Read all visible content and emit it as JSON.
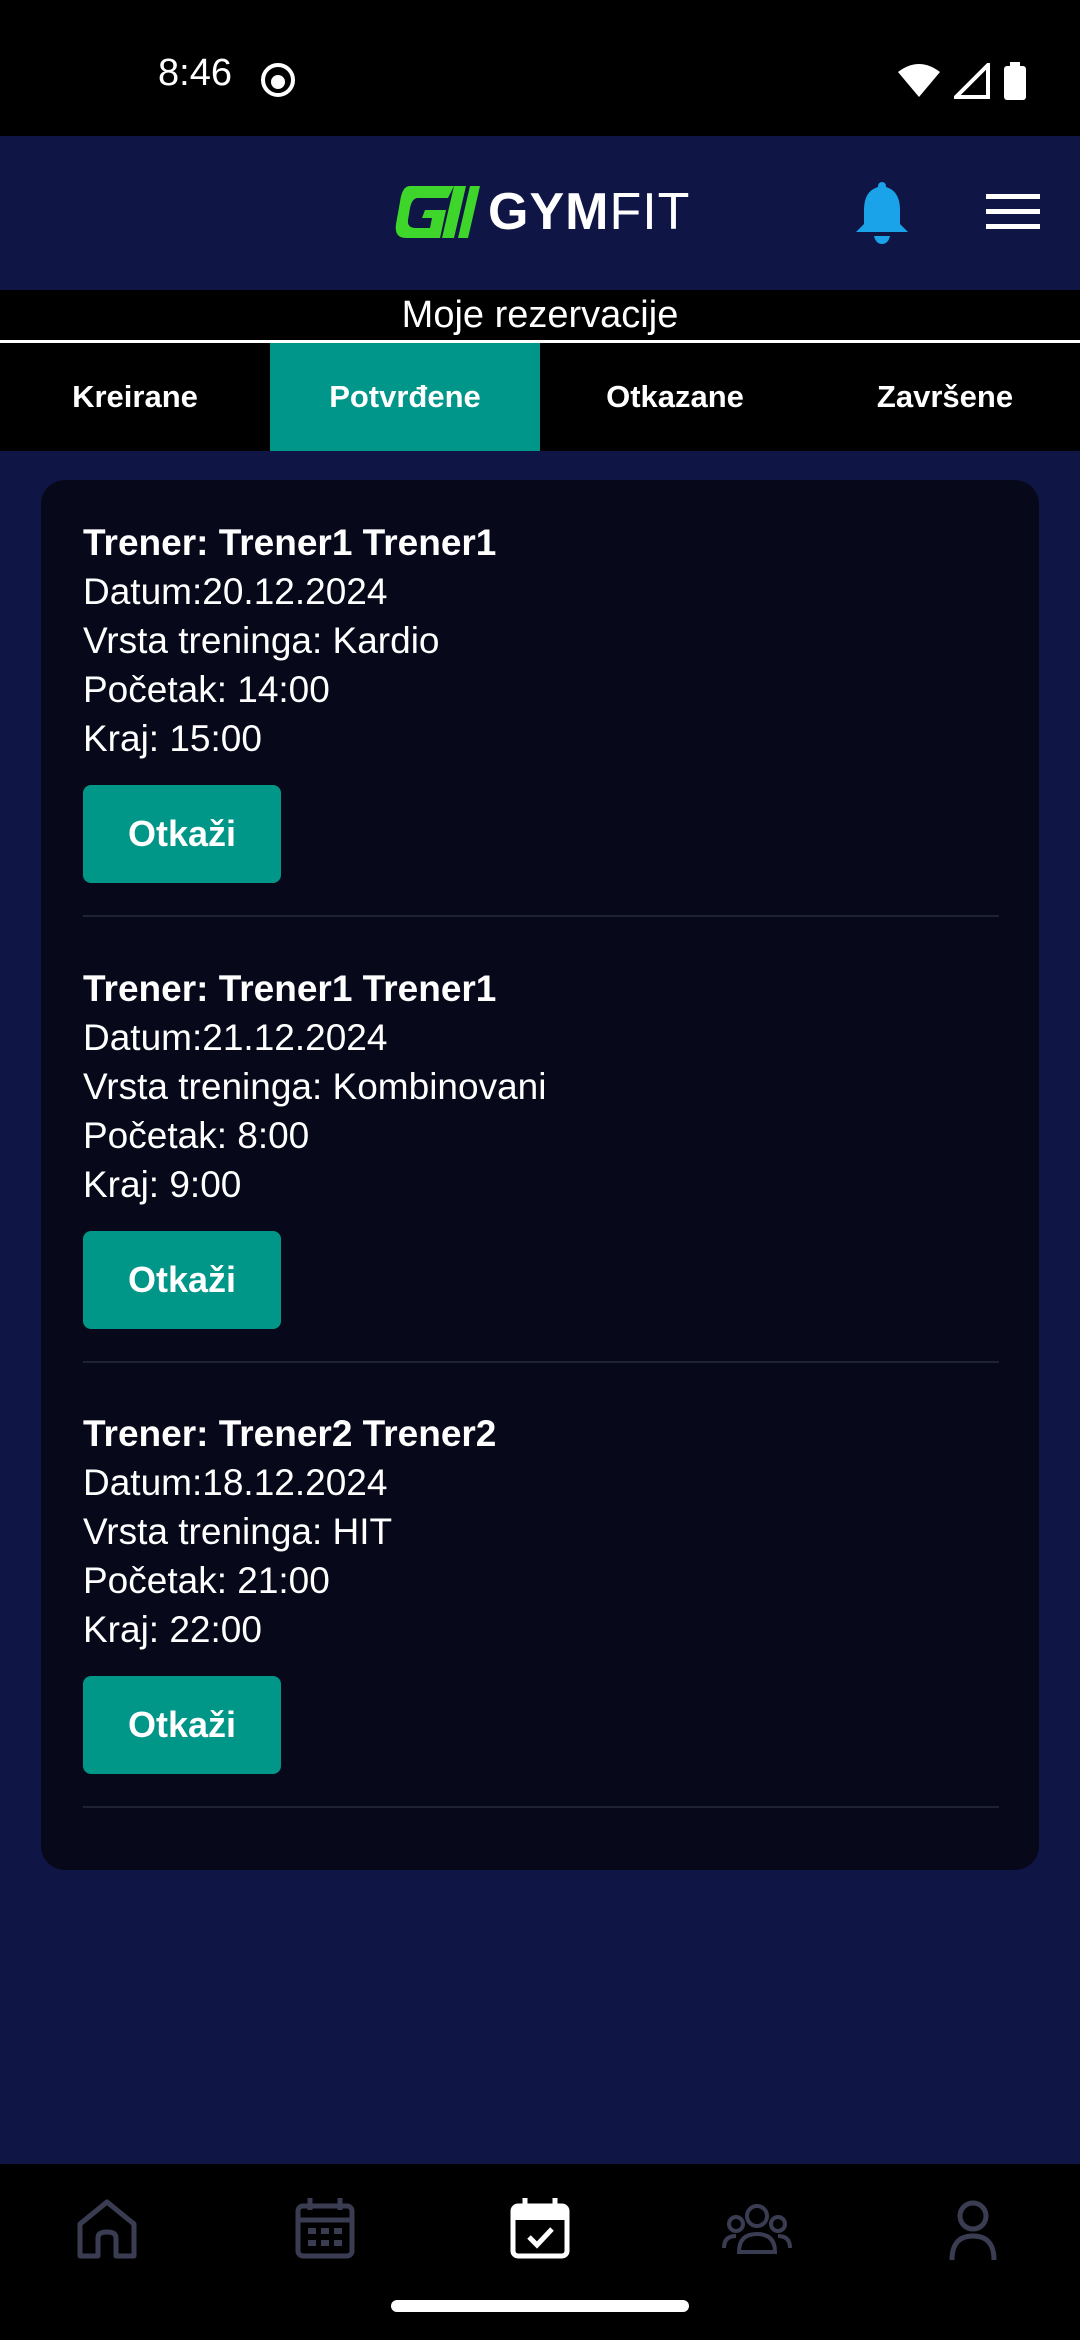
{
  "status_bar": {
    "time": "8:46"
  },
  "header": {
    "logo_text_bold": "GYM",
    "logo_text_light": "FIT"
  },
  "section_title": "Moje rezervacije",
  "tabs": [
    {
      "label": "Kreirane",
      "active": false
    },
    {
      "label": "Potvrđene",
      "active": true
    },
    {
      "label": "Otkazane",
      "active": false
    },
    {
      "label": "Završene",
      "active": false
    }
  ],
  "reservations": [
    {
      "trainer": "Trener: Trener1 Trener1",
      "date": "Datum:20.12.2024",
      "type": "Vrsta treninga: Kardio",
      "start": "Početak: 14:00",
      "end": "Kraj: 15:00",
      "button": "Otkaži"
    },
    {
      "trainer": "Trener: Trener1 Trener1",
      "date": "Datum:21.12.2024",
      "type": "Vrsta treninga: Kombinovani",
      "start": "Početak: 8:00",
      "end": "Kraj: 9:00",
      "button": "Otkaži"
    },
    {
      "trainer": "Trener: Trener2 Trener2",
      "date": "Datum:18.12.2024",
      "type": "Vrsta treninga: HIT",
      "start": "Početak: 21:00",
      "end": "Kraj: 22:00",
      "button": "Otkaži"
    }
  ],
  "bottom_nav": [
    {
      "icon": "home-icon",
      "active": false
    },
    {
      "icon": "calendar-icon",
      "active": false
    },
    {
      "icon": "calendar-check-icon",
      "active": true
    },
    {
      "icon": "group-icon",
      "active": false
    },
    {
      "icon": "profile-icon",
      "active": false
    }
  ],
  "colors": {
    "accent": "#009688",
    "background": "#0f1645",
    "card": "#07081a",
    "bell": "#1aa3e8"
  }
}
